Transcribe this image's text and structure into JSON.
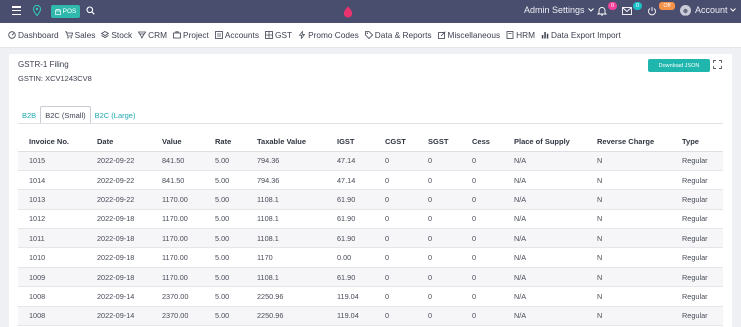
{
  "colors": {
    "topbar": "#4a4e6e",
    "accent": "#1fb7ad",
    "badge_pink": "#f2419a",
    "badge_teal": "#1cc0c8",
    "badge_orange": "#f6924a"
  },
  "topbar": {
    "pos_label": "POS",
    "admin_settings": "Admin Settings",
    "bell_badge": "0",
    "mail_badge": "0",
    "status_badge": "Off",
    "account_label": "Account"
  },
  "nav": {
    "items": [
      {
        "label": "Dashboard",
        "icon": "dashboard-icon"
      },
      {
        "label": "Sales",
        "icon": "cart-icon"
      },
      {
        "label": "Stock",
        "icon": "layers-icon"
      },
      {
        "label": "CRM",
        "icon": "crm-icon"
      },
      {
        "label": "Project",
        "icon": "briefcase-icon"
      },
      {
        "label": "Accounts",
        "icon": "ledger-icon"
      },
      {
        "label": "GST",
        "icon": "gst-icon"
      },
      {
        "label": "Promo Codes",
        "icon": "bolt-icon"
      },
      {
        "label": "Data & Reports",
        "icon": "tag-icon"
      },
      {
        "label": "Miscellaneous",
        "icon": "edit-icon"
      },
      {
        "label": "HRM",
        "icon": "book-icon"
      },
      {
        "label": "Data Export Import",
        "icon": "bar-chart-icon"
      }
    ]
  },
  "card": {
    "title": "GSTR-1 Filing",
    "gstin": "GSTIN: XCV1243CV8",
    "download_label": "Download JSON"
  },
  "tabs": [
    {
      "label": "B2B"
    },
    {
      "label": "B2C (Small)"
    },
    {
      "label": "B2C (Large)"
    }
  ],
  "table": {
    "headers": [
      "Invoice No.",
      "Date",
      "Value",
      "Rate",
      "Taxable Value",
      "IGST",
      "CGST",
      "SGST",
      "Cess",
      "Place of Supply",
      "Reverse Charge",
      "Type"
    ],
    "rows": [
      [
        "1015",
        "2022-09-22",
        "841.50",
        "5.00",
        "794.36",
        "47.14",
        "0",
        "0",
        "0",
        "N/A",
        "N",
        "Regular"
      ],
      [
        "1014",
        "2022-09-22",
        "841.50",
        "5.00",
        "794.36",
        "47.14",
        "0",
        "0",
        "0",
        "N/A",
        "N",
        "Regular"
      ],
      [
        "1013",
        "2022-09-22",
        "1170.00",
        "5.00",
        "1108.1",
        "61.90",
        "0",
        "0",
        "0",
        "N/A",
        "N",
        "Regular"
      ],
      [
        "1012",
        "2022-09-18",
        "1170.00",
        "5.00",
        "1108.1",
        "61.90",
        "0",
        "0",
        "0",
        "N/A",
        "N",
        "Regular"
      ],
      [
        "1011",
        "2022-09-18",
        "1170.00",
        "5.00",
        "1108.1",
        "61.90",
        "0",
        "0",
        "0",
        "N/A",
        "N",
        "Regular"
      ],
      [
        "1010",
        "2022-09-18",
        "1170.00",
        "5.00",
        "1170",
        "0.00",
        "0",
        "0",
        "0",
        "N/A",
        "N",
        "Regular"
      ],
      [
        "1009",
        "2022-09-18",
        "1170.00",
        "5.00",
        "1108.1",
        "61.90",
        "0",
        "0",
        "0",
        "N/A",
        "N",
        "Regular"
      ],
      [
        "1008",
        "2022-09-14",
        "2370.00",
        "5.00",
        "2250.96",
        "119.04",
        "0",
        "0",
        "0",
        "N/A",
        "N",
        "Regular"
      ],
      [
        "1008",
        "2022-09-14",
        "2370.00",
        "5.00",
        "2250.96",
        "119.04",
        "0",
        "0",
        "0",
        "N/A",
        "N",
        "Regular"
      ]
    ]
  }
}
